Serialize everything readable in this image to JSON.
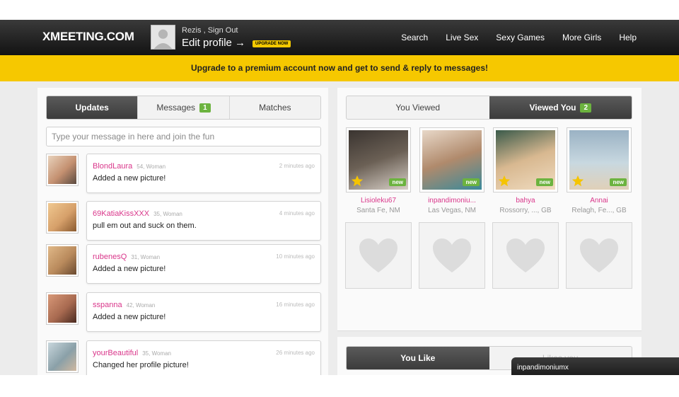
{
  "header": {
    "logo": "XMEETING.COM",
    "username": "Rezis",
    "sign_out": "Sign Out",
    "edit_profile": "Edit profile →",
    "upgrade_badge": "UPGRADE NOW",
    "nav": [
      "Search",
      "Live Sex",
      "Sexy Games",
      "More Girls",
      "Help"
    ]
  },
  "promo": "Upgrade to a premium account now and get to send & reply to messages!",
  "left": {
    "tabs": [
      {
        "label": "Updates",
        "active": true
      },
      {
        "label": "Messages",
        "count": "1"
      },
      {
        "label": "Matches"
      }
    ],
    "compose_placeholder": "Type your message in here and join the fun",
    "feed": [
      {
        "name": "BlondLaura",
        "meta": "54, Woman",
        "time": "2 minutes ago",
        "message": "Added a new picture!",
        "color": "#c49070"
      },
      {
        "name": "69KatiaKissXXX",
        "meta": "35, Woman",
        "time": "4 minutes ago",
        "message": "pull em out and suck on them.",
        "color": "#d6a06a"
      },
      {
        "name": "rubenesQ",
        "meta": "31, Woman",
        "time": "10 minutes ago",
        "message": "Added a new picture!",
        "color": "#b98a5c"
      },
      {
        "name": "sspanna",
        "meta": "42, Woman",
        "time": "16 minutes ago",
        "message": "Added a new picture!",
        "color": "#a86a50"
      },
      {
        "name": "yourBeautiful",
        "meta": "35, Woman",
        "time": "26 minutes ago",
        "message": "Changed her profile picture!",
        "color": "#8aa0a8"
      }
    ]
  },
  "right": {
    "tabs": [
      {
        "label": "You Viewed"
      },
      {
        "label": "Viewed You",
        "count": "2",
        "active": true
      }
    ],
    "profiles": [
      {
        "name": "Lisioleku67",
        "location": "Santa Fe, NM",
        "new_label": "new",
        "color": "#6b6055"
      },
      {
        "name": "inpandimoniu...",
        "location": "Las Vegas, NM",
        "new_label": "new",
        "color": "#b08a6c"
      },
      {
        "name": "bahya",
        "location": "Rossorry, ..., GB",
        "new_label": "new",
        "color": "#d8b890"
      },
      {
        "name": "Annai",
        "location": "Relagh, Fe..., GB",
        "new_label": "new",
        "color": "#9ab2c4"
      }
    ],
    "like_tabs": [
      {
        "label": "You Like",
        "active": true
      },
      {
        "label": "Likes you"
      }
    ]
  },
  "chat": {
    "username": "inpandimoniumx"
  },
  "colors": {
    "accent": "#f6c800",
    "link": "#d9368a",
    "badge": "#6cb33f"
  }
}
